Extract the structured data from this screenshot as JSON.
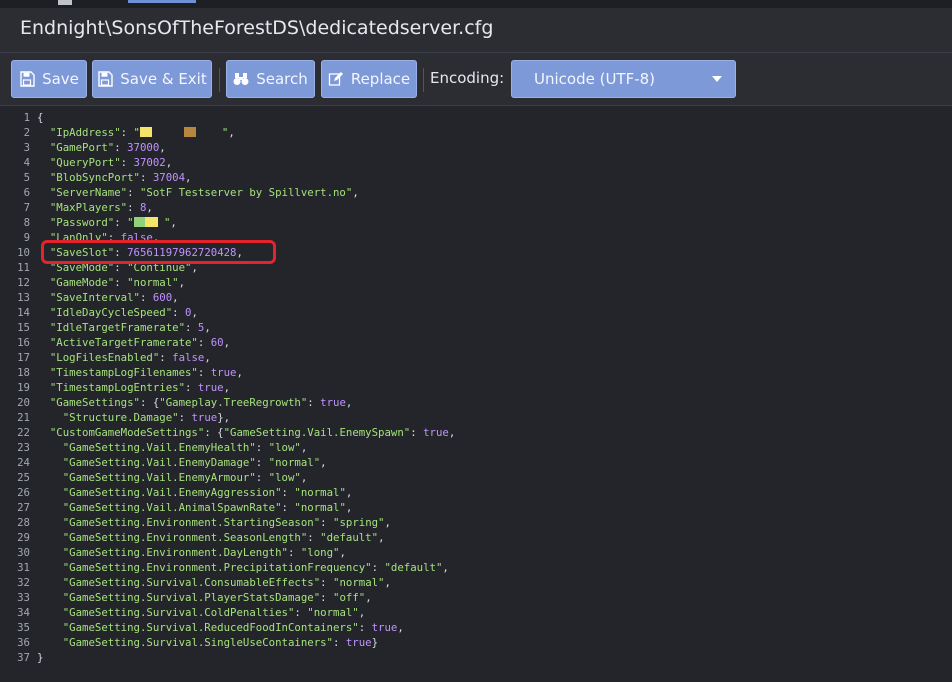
{
  "window": {
    "title": "Endnight\\SonsOfTheForestDS\\dedicatedserver.cfg"
  },
  "toolbar": {
    "save_label": "Save",
    "save_exit_label": "Save & Exit",
    "search_label": "Search",
    "replace_label": "Replace",
    "encoding_label": "Encoding:",
    "encoding_value": "Unicode (UTF-8)"
  },
  "colors": {
    "button": "#7e99d8",
    "string": "#a5e27c",
    "number": "#c193ff",
    "highlight": "#e3242b"
  },
  "editor": {
    "highlighted_line": 10,
    "lines": [
      [
        [
          "p",
          "{"
        ]
      ],
      [
        [
          "p",
          "  "
        ],
        [
          "s",
          "\"IpAddress\""
        ],
        [
          "p",
          ": "
        ],
        [
          "s",
          "\""
        ],
        [
          "r1",
          ""
        ],
        [
          "s",
          "     "
        ],
        [
          "r2",
          ""
        ],
        [
          "s",
          "    \""
        ],
        [
          "p",
          ","
        ]
      ],
      [
        [
          "p",
          "  "
        ],
        [
          "s",
          "\"GamePort\""
        ],
        [
          "p",
          ": "
        ],
        [
          "n",
          "37000"
        ],
        [
          "p",
          ","
        ]
      ],
      [
        [
          "p",
          "  "
        ],
        [
          "s",
          "\"QueryPort\""
        ],
        [
          "p",
          ": "
        ],
        [
          "n",
          "37002"
        ],
        [
          "p",
          ","
        ]
      ],
      [
        [
          "p",
          "  "
        ],
        [
          "s",
          "\"BlobSyncPort\""
        ],
        [
          "p",
          ": "
        ],
        [
          "n",
          "37004"
        ],
        [
          "p",
          ","
        ]
      ],
      [
        [
          "p",
          "  "
        ],
        [
          "s",
          "\"ServerName\""
        ],
        [
          "p",
          ": "
        ],
        [
          "s",
          "\"SotF Testserver by Spillvert.no\""
        ],
        [
          "p",
          ","
        ]
      ],
      [
        [
          "p",
          "  "
        ],
        [
          "s",
          "\"MaxPlayers\""
        ],
        [
          "p",
          ": "
        ],
        [
          "n",
          "8"
        ],
        [
          "p",
          ","
        ]
      ],
      [
        [
          "p",
          "  "
        ],
        [
          "s",
          "\"Password\""
        ],
        [
          "p",
          ": "
        ],
        [
          "s",
          "\""
        ],
        [
          "r3",
          ""
        ],
        [
          "s",
          " \""
        ],
        [
          "p",
          ","
        ]
      ],
      [
        [
          "p",
          "  "
        ],
        [
          "s",
          "\"LanOnly\""
        ],
        [
          "p",
          ": "
        ],
        [
          "n",
          "false"
        ],
        [
          "p",
          ","
        ]
      ],
      [
        [
          "p",
          "  "
        ],
        [
          "s",
          "\"SaveSlot\""
        ],
        [
          "p",
          ": "
        ],
        [
          "n",
          "76561197962720428"
        ],
        [
          "p",
          ","
        ]
      ],
      [
        [
          "p",
          "  "
        ],
        [
          "s",
          "\"SaveMode\""
        ],
        [
          "p",
          ": "
        ],
        [
          "s",
          "\"Continue\""
        ],
        [
          "p",
          ","
        ]
      ],
      [
        [
          "p",
          "  "
        ],
        [
          "s",
          "\"GameMode\""
        ],
        [
          "p",
          ": "
        ],
        [
          "s",
          "\"normal\""
        ],
        [
          "p",
          ","
        ]
      ],
      [
        [
          "p",
          "  "
        ],
        [
          "s",
          "\"SaveInterval\""
        ],
        [
          "p",
          ": "
        ],
        [
          "n",
          "600"
        ],
        [
          "p",
          ","
        ]
      ],
      [
        [
          "p",
          "  "
        ],
        [
          "s",
          "\"IdleDayCycleSpeed\""
        ],
        [
          "p",
          ": "
        ],
        [
          "n",
          "0"
        ],
        [
          "p",
          ","
        ]
      ],
      [
        [
          "p",
          "  "
        ],
        [
          "s",
          "\"IdleTargetFramerate\""
        ],
        [
          "p",
          ": "
        ],
        [
          "n",
          "5"
        ],
        [
          "p",
          ","
        ]
      ],
      [
        [
          "p",
          "  "
        ],
        [
          "s",
          "\"ActiveTargetFramerate\""
        ],
        [
          "p",
          ": "
        ],
        [
          "n",
          "60"
        ],
        [
          "p",
          ","
        ]
      ],
      [
        [
          "p",
          "  "
        ],
        [
          "s",
          "\"LogFilesEnabled\""
        ],
        [
          "p",
          ": "
        ],
        [
          "n",
          "false"
        ],
        [
          "p",
          ","
        ]
      ],
      [
        [
          "p",
          "  "
        ],
        [
          "s",
          "\"TimestampLogFilenames\""
        ],
        [
          "p",
          ": "
        ],
        [
          "n",
          "true"
        ],
        [
          "p",
          ","
        ]
      ],
      [
        [
          "p",
          "  "
        ],
        [
          "s",
          "\"TimestampLogEntries\""
        ],
        [
          "p",
          ": "
        ],
        [
          "n",
          "true"
        ],
        [
          "p",
          ","
        ]
      ],
      [
        [
          "p",
          "  "
        ],
        [
          "s",
          "\"GameSettings\""
        ],
        [
          "p",
          ": {"
        ],
        [
          "s",
          "\"Gameplay.TreeRegrowth\""
        ],
        [
          "p",
          ": "
        ],
        [
          "n",
          "true"
        ],
        [
          "p",
          ","
        ]
      ],
      [
        [
          "p",
          "    "
        ],
        [
          "s",
          "\"Structure.Damage\""
        ],
        [
          "p",
          ": "
        ],
        [
          "n",
          "true"
        ],
        [
          "p",
          "},"
        ]
      ],
      [
        [
          "p",
          "  "
        ],
        [
          "s",
          "\"CustomGameModeSettings\""
        ],
        [
          "p",
          ": {"
        ],
        [
          "s",
          "\"GameSetting.Vail.EnemySpawn\""
        ],
        [
          "p",
          ": "
        ],
        [
          "n",
          "true"
        ],
        [
          "p",
          ","
        ]
      ],
      [
        [
          "p",
          "    "
        ],
        [
          "s",
          "\"GameSetting.Vail.EnemyHealth\""
        ],
        [
          "p",
          ": "
        ],
        [
          "s",
          "\"low\""
        ],
        [
          "p",
          ","
        ]
      ],
      [
        [
          "p",
          "    "
        ],
        [
          "s",
          "\"GameSetting.Vail.EnemyDamage\""
        ],
        [
          "p",
          ": "
        ],
        [
          "s",
          "\"normal\""
        ],
        [
          "p",
          ","
        ]
      ],
      [
        [
          "p",
          "    "
        ],
        [
          "s",
          "\"GameSetting.Vail.EnemyArmour\""
        ],
        [
          "p",
          ": "
        ],
        [
          "s",
          "\"low\""
        ],
        [
          "p",
          ","
        ]
      ],
      [
        [
          "p",
          "    "
        ],
        [
          "s",
          "\"GameSetting.Vail.EnemyAggression\""
        ],
        [
          "p",
          ": "
        ],
        [
          "s",
          "\"normal\""
        ],
        [
          "p",
          ","
        ]
      ],
      [
        [
          "p",
          "    "
        ],
        [
          "s",
          "\"GameSetting.Vail.AnimalSpawnRate\""
        ],
        [
          "p",
          ": "
        ],
        [
          "s",
          "\"normal\""
        ],
        [
          "p",
          ","
        ]
      ],
      [
        [
          "p",
          "    "
        ],
        [
          "s",
          "\"GameSetting.Environment.StartingSeason\""
        ],
        [
          "p",
          ": "
        ],
        [
          "s",
          "\"spring\""
        ],
        [
          "p",
          ","
        ]
      ],
      [
        [
          "p",
          "    "
        ],
        [
          "s",
          "\"GameSetting.Environment.SeasonLength\""
        ],
        [
          "p",
          ": "
        ],
        [
          "s",
          "\"default\""
        ],
        [
          "p",
          ","
        ]
      ],
      [
        [
          "p",
          "    "
        ],
        [
          "s",
          "\"GameSetting.Environment.DayLength\""
        ],
        [
          "p",
          ": "
        ],
        [
          "s",
          "\"long\""
        ],
        [
          "p",
          ","
        ]
      ],
      [
        [
          "p",
          "    "
        ],
        [
          "s",
          "\"GameSetting.Environment.PrecipitationFrequency\""
        ],
        [
          "p",
          ": "
        ],
        [
          "s",
          "\"default\""
        ],
        [
          "p",
          ","
        ]
      ],
      [
        [
          "p",
          "    "
        ],
        [
          "s",
          "\"GameSetting.Survival.ConsumableEffects\""
        ],
        [
          "p",
          ": "
        ],
        [
          "s",
          "\"normal\""
        ],
        [
          "p",
          ","
        ]
      ],
      [
        [
          "p",
          "    "
        ],
        [
          "s",
          "\"GameSetting.Survival.PlayerStatsDamage\""
        ],
        [
          "p",
          ": "
        ],
        [
          "s",
          "\"off\""
        ],
        [
          "p",
          ","
        ]
      ],
      [
        [
          "p",
          "    "
        ],
        [
          "s",
          "\"GameSetting.Survival.ColdPenalties\""
        ],
        [
          "p",
          ": "
        ],
        [
          "s",
          "\"normal\""
        ],
        [
          "p",
          ","
        ]
      ],
      [
        [
          "p",
          "    "
        ],
        [
          "s",
          "\"GameSetting.Survival.ReducedFoodInContainers\""
        ],
        [
          "p",
          ": "
        ],
        [
          "n",
          "true"
        ],
        [
          "p",
          ","
        ]
      ],
      [
        [
          "p",
          "    "
        ],
        [
          "s",
          "\"GameSetting.Survival.SingleUseContainers\""
        ],
        [
          "p",
          ": "
        ],
        [
          "n",
          "true"
        ],
        [
          "p",
          "}"
        ]
      ],
      [
        [
          "p",
          "}"
        ]
      ]
    ]
  }
}
